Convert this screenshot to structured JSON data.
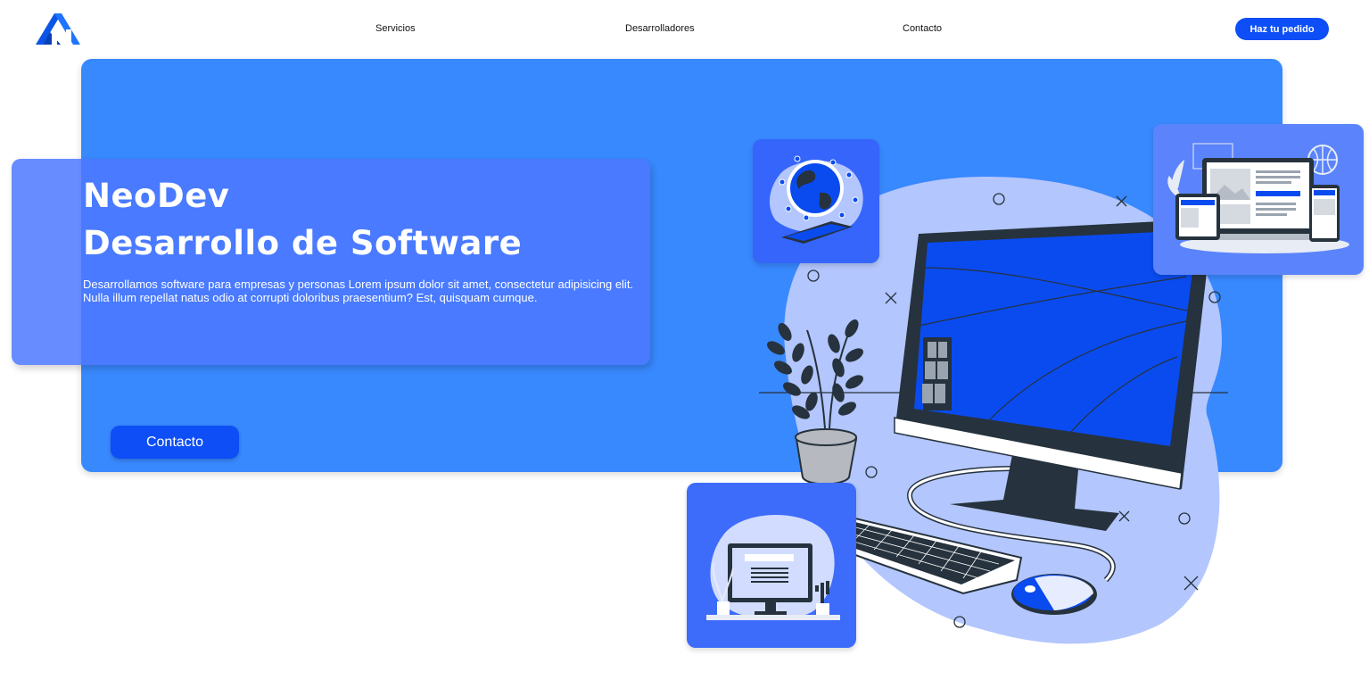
{
  "nav": {
    "links": [
      "Servicios",
      "Desarrolladores",
      "Contacto"
    ],
    "order_button": "Haz tu pedido"
  },
  "hero": {
    "title": "NeoDev",
    "subtitle": "Desarrollo de Software",
    "description": "Desarrollamos software para empresas y personas Lorem ipsum dolor sit amet, consectetur adipisicing elit. Nulla illum repellat natus odio at corrupti doloribus praesentium? Est, quisquam cumque.",
    "contact_button": "Contacto"
  },
  "icons": {
    "logo": "neodev-logo-icon",
    "illustration": "computer-illustration",
    "globe_card": "globe-network-icon",
    "devices_card": "responsive-devices-icon",
    "desk_card": "desk-computer-icon"
  },
  "colors": {
    "accent": "#0d4ef7",
    "hero_bg": "#3888fe",
    "card_bg": "#4c78ff"
  }
}
